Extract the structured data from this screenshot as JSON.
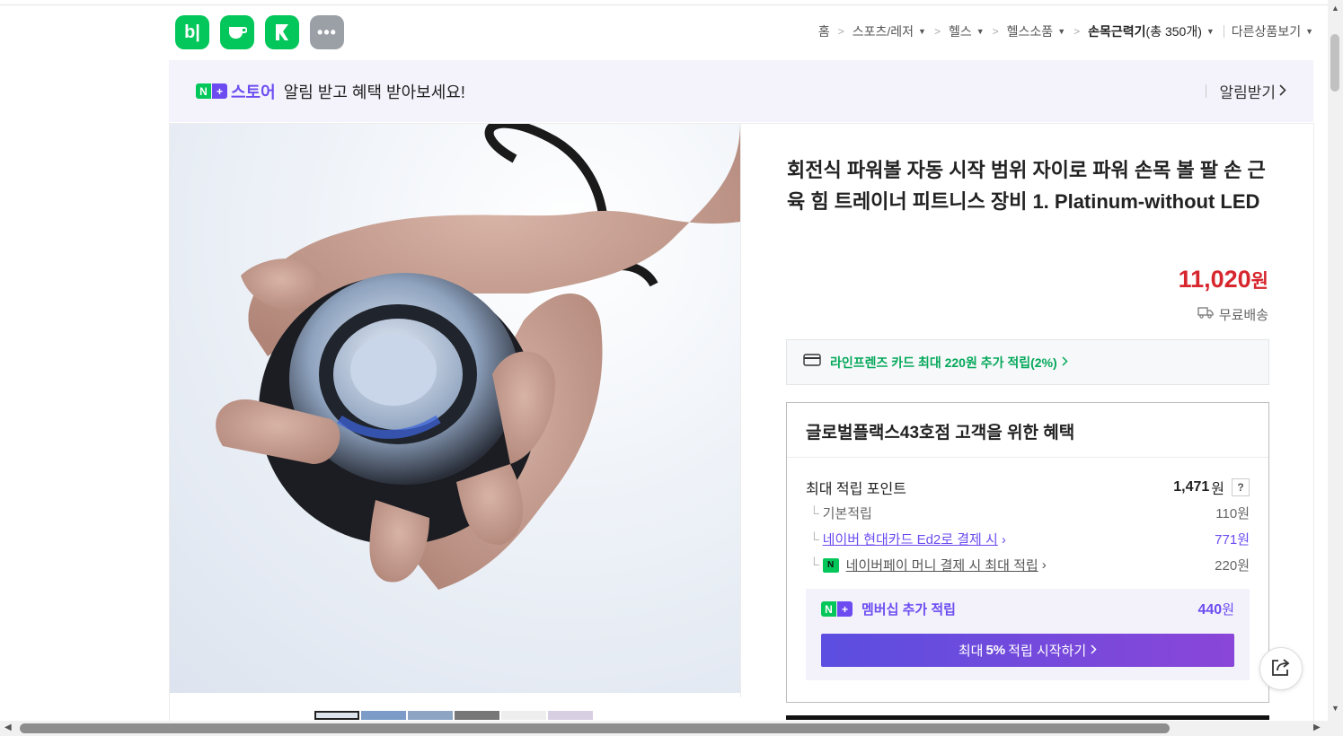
{
  "apps": [
    {
      "label": "b|",
      "icon": "blog-icon"
    },
    {
      "label": "☕",
      "icon": "cafe-icon"
    },
    {
      "label": "▶",
      "icon": "mark-icon"
    },
    {
      "label": "•••",
      "icon": "more-icon"
    }
  ],
  "breadcrumb": {
    "home": "홈",
    "items": [
      "스포츠/레저",
      "헬스",
      "헬스소품"
    ],
    "current_prefix": "손목근력기",
    "current_count": "(총 350개)",
    "other": "다른상품보기"
  },
  "banner": {
    "n_label": "N",
    "plus_label": "+",
    "store_label": "스토어",
    "message": "알림 받고 혜택 받아보세요!",
    "alarm_button": "알림받기"
  },
  "product": {
    "title": "회전식 파워볼 자동 시작 범위 자이로 파워 손목 볼 팔 손 근육 힘 트레이너 피트니스 장비 1. Platinum-without LED",
    "price": "11,020",
    "price_unit": "원",
    "shipping": "무료배송",
    "card_benefit": "라인프렌즈 카드 최대 220원 추가 적립(2%)"
  },
  "benefit": {
    "heading": "글로벌플랙스43호점 고객을 위한 혜택",
    "max_points_label": "최대 적립 포인트",
    "max_points_value": "1,471",
    "max_points_unit": "원",
    "help_label": "?",
    "rows": [
      {
        "label": "기본적립",
        "value": "110원"
      },
      {
        "label": "네이버 현대카드 Ed2로 결제 시",
        "value": "771원"
      },
      {
        "label": "네이버페이 머니 결제 시 최대 적립",
        "value": "220원"
      }
    ],
    "npay_label": "N",
    "membership_label": "멤버십 추가 적립",
    "membership_value": "440",
    "membership_unit": "원",
    "cta_prefix": "최대",
    "cta_bold": "5%",
    "cta_suffix": "적립 시작하기"
  },
  "colors": {
    "naver_green": "#03c75a",
    "plus_purple": "#6c4cf1",
    "price_red": "#d7262e"
  }
}
